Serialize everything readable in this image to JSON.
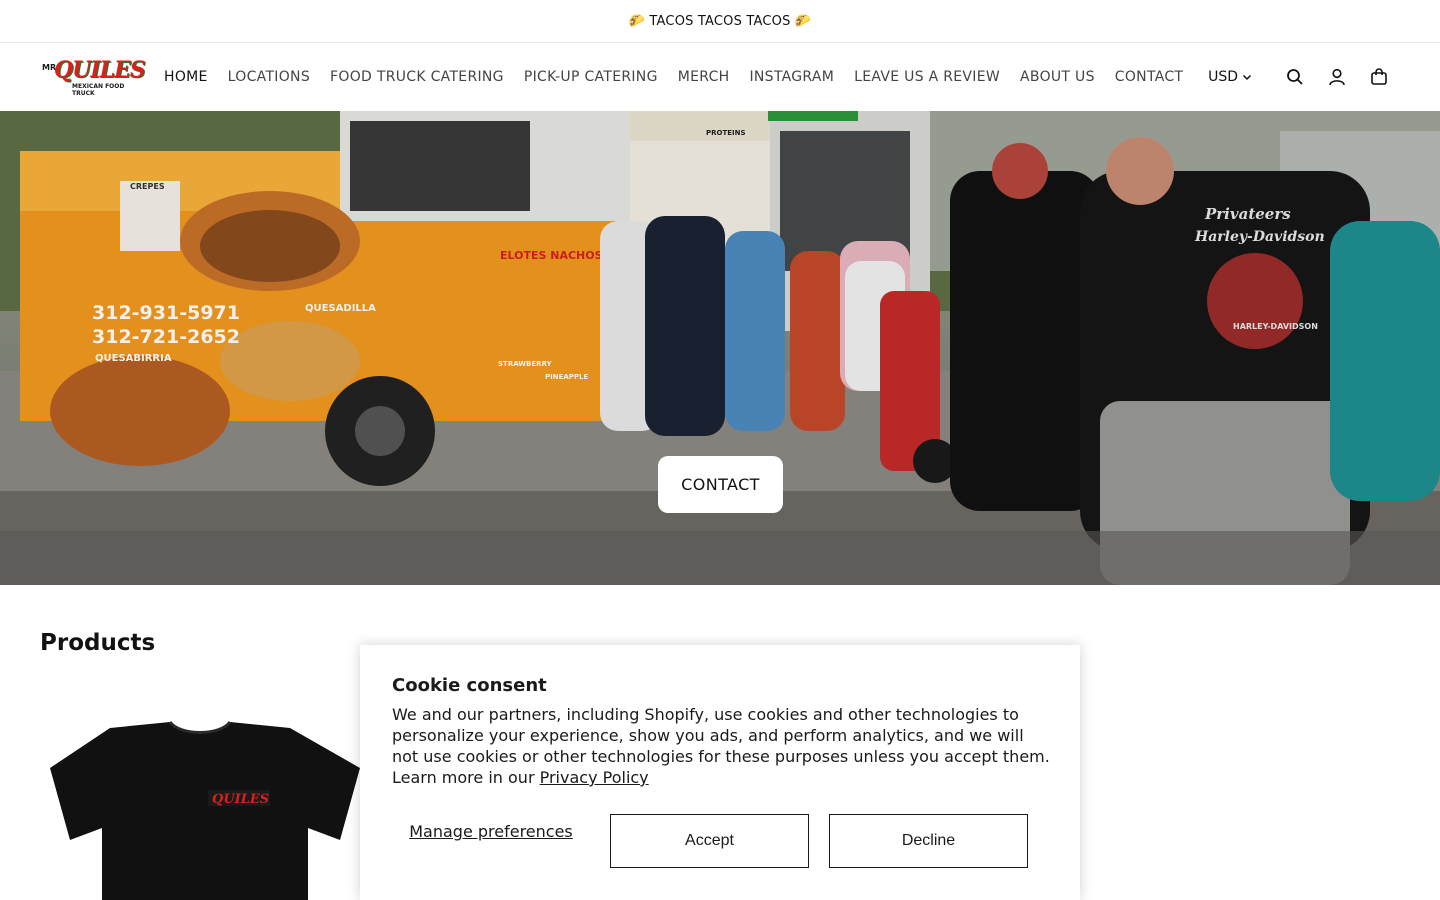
{
  "announcement": {
    "text": "🌮 TACOS TACOS TACOS 🌮"
  },
  "header": {
    "logo": {
      "mr": "MR",
      "name": "QUILES",
      "tagline": "MEXICAN FOOD TRUCK"
    },
    "nav": [
      {
        "label": "HOME",
        "active": true
      },
      {
        "label": "LOCATIONS"
      },
      {
        "label": "FOOD TRUCK CATERING"
      },
      {
        "label": "PICK-UP CATERING"
      },
      {
        "label": "MERCH"
      },
      {
        "label": "INSTAGRAM"
      },
      {
        "label": "LEAVE US A REVIEW"
      },
      {
        "label": "ABOUT US"
      },
      {
        "label": "CONTACT"
      }
    ],
    "currency": "USD",
    "icons": [
      "search-icon",
      "account-icon",
      "cart-icon"
    ]
  },
  "hero": {
    "button_label": "CONTACT",
    "truck_phone_1": "312-931-5971",
    "truck_phone_2": "312-721-2652",
    "truck_labels": [
      "QUESADILLA",
      "QUESABIRRIA",
      "ELOTES NACHOS",
      "CREPES",
      "STRAWBERRY",
      "PINEAPPLE",
      "PROTEINS"
    ],
    "shirt_text_1": "Privateers",
    "shirt_text_2": "Harley-Davidson",
    "shirt_text_3": "HARLEY-DAVIDSON"
  },
  "products": {
    "title": "Products",
    "item_logo_text": "QUILES"
  },
  "cookie": {
    "title": "Cookie consent",
    "text": "We and our partners, including Shopify, use cookies and other technologies to personalize your experience, show you ads, and perform analytics, and we will not use cookies or other technologies for these purposes unless you accept them. Learn more in our ",
    "link": "Privacy Policy",
    "manage": "Manage preferences",
    "accept": "Accept",
    "decline": "Decline"
  },
  "colors": {
    "brand_red": "#d8201e",
    "brand_green": "#1d7a2b",
    "text": "#121212",
    "truck_orange": "#f29a1f"
  }
}
